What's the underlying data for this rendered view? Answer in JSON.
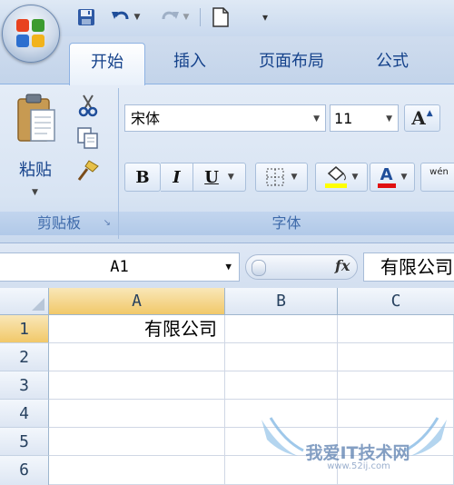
{
  "quick_access": {
    "items": [
      "save-icon",
      "undo-icon",
      "redo-icon",
      "new-document-icon",
      "customize-icon"
    ]
  },
  "tabs": [
    {
      "label": "开始",
      "active": true
    },
    {
      "label": "插入",
      "active": false
    },
    {
      "label": "页面布局",
      "active": false
    },
    {
      "label": "公式",
      "active": false
    }
  ],
  "clipboard": {
    "paste_label": "粘贴",
    "group_label": "剪贴板"
  },
  "font": {
    "name": "宋体",
    "size": "11",
    "bold": "B",
    "italic": "I",
    "underline": "U",
    "font_color_glyph": "A",
    "grow_glyph": "A",
    "wen_glyph": "wén",
    "group_label": "字体",
    "highlight_color": "#ffff00",
    "font_color": "#e01010"
  },
  "formula_bar": {
    "name_box": "A1",
    "fx": "fx",
    "content": "有限公司"
  },
  "grid": {
    "columns": [
      "A",
      "B",
      "C"
    ],
    "rows": [
      "1",
      "2",
      "3",
      "4",
      "5",
      "6"
    ],
    "cells": {
      "A1": "有限公司"
    }
  },
  "watermark": {
    "text": "我爱IT技术网",
    "url": "www.52ij.com"
  }
}
